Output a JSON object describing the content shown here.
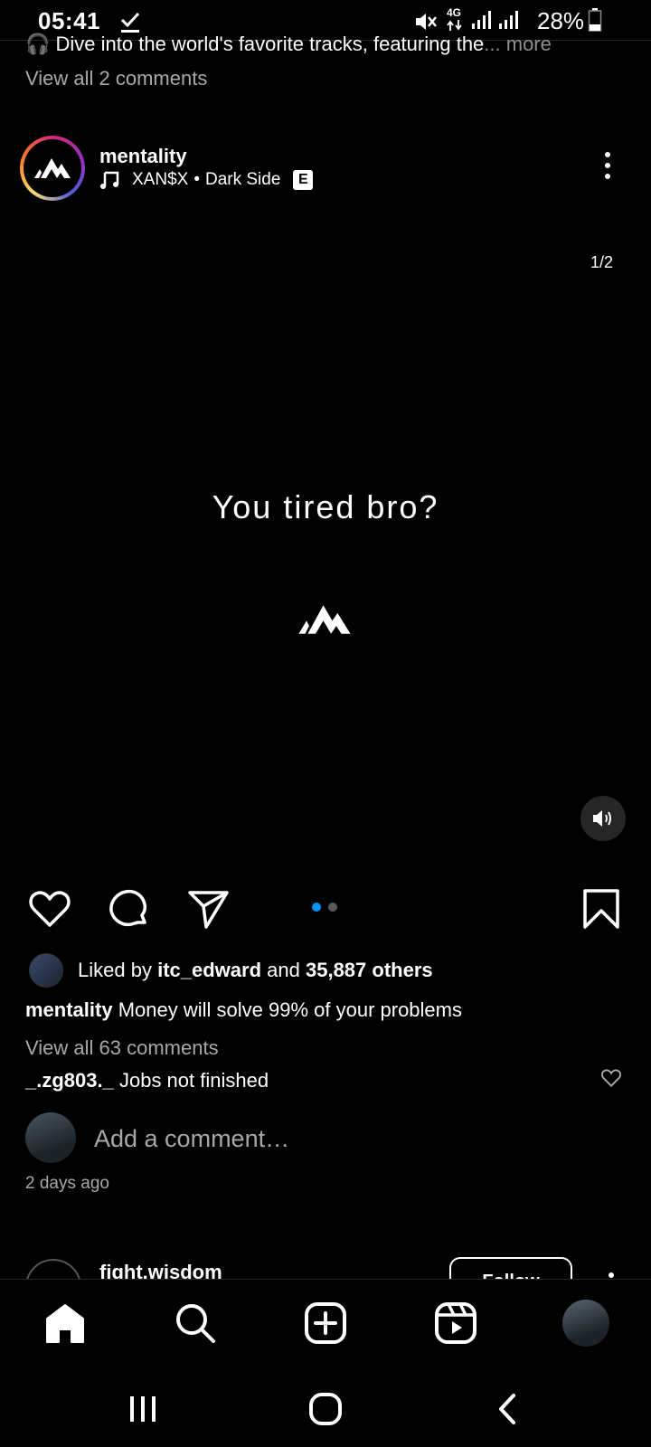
{
  "status_bar": {
    "time": "05:41",
    "network": "4G",
    "battery": "28%"
  },
  "previous_post": {
    "caption_text": "Dive into the world's favorite tracks, featuring the",
    "caption_more": "... more",
    "view_comments": "View all 2 comments"
  },
  "post": {
    "username": "mentality",
    "music_artist": "XAN$X",
    "music_title": "Dark Side",
    "explicit_badge": "E",
    "page_counter": "1/2",
    "media_text": "You tired bro?",
    "carousel": {
      "total": 2,
      "active": 0
    },
    "liked_by_user": "itc_edward",
    "liked_prefix": "Liked by",
    "liked_and": "and",
    "liked_count": "35,887 others",
    "caption_user": "mentality",
    "caption_text": "Money will solve 99% of your problems",
    "view_comments": "View all 63 comments",
    "top_comment_user": "_.zg803._",
    "top_comment_text": "Jobs not finished",
    "add_comment_placeholder": "Add a comment…",
    "timestamp": "2 days ago"
  },
  "next_post": {
    "username": "fight.wisdom",
    "follow_label": "Follow"
  },
  "colors": {
    "background": "#000000",
    "accent_blue": "#0095f6",
    "secondary_text": "#a8a8a8"
  },
  "icons": {
    "like": "heart-icon",
    "comment": "comment-icon",
    "share": "send-icon",
    "save": "bookmark-icon",
    "home": "home-icon",
    "search": "search-icon",
    "create": "add-square-icon",
    "reels": "reels-icon"
  }
}
